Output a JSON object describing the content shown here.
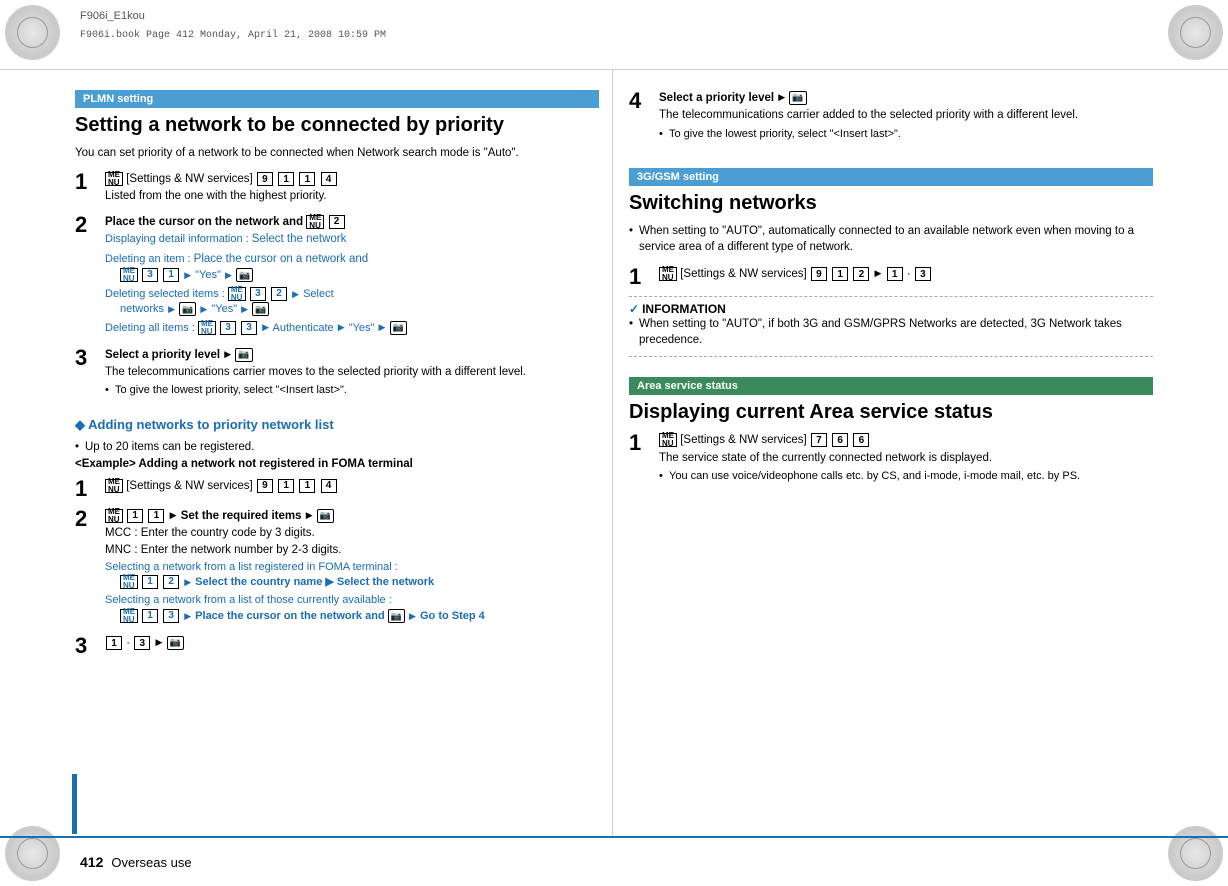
{
  "header": {
    "title": "F906i_E1kou",
    "subtitle": "F906i.book  Page 412  Monday, April 21, 2008  10:59 PM"
  },
  "page": {
    "number": "412",
    "label": "Overseas use"
  },
  "left_section": {
    "header": "PLMN setting",
    "title": "Setting a network to be connected by priority",
    "intro": "You can set priority of a network to be connected when Network search mode is \"Auto\".",
    "steps": [
      {
        "number": "1",
        "menu_label": "ME/NU",
        "keys": [
          "[Settings & NW services]",
          "9",
          "1",
          "1",
          "4"
        ],
        "body": "Listed from the one with the highest priority."
      },
      {
        "number": "2",
        "body": "Place the cursor on the network and",
        "menu_label": "ME/NU",
        "key2": "2",
        "sub_items": [
          {
            "label": "Displaying detail information :",
            "text": "Select the network"
          },
          {
            "label": "Deleting an item :",
            "text": "Place the cursor on a network and",
            "extra": "3 1 ▶ \"Yes\" ▶ 🔒"
          },
          {
            "label": "Deleting selected items :",
            "text": "3 2 ▶ Select networks ▶ 🔒 ▶ \"Yes\" ▶ 🔒"
          },
          {
            "label": "Deleting all items :",
            "text": "3 3 ▶ Authenticate ▶ \"Yes\" ▶ 🔒"
          }
        ]
      },
      {
        "number": "3",
        "body": "Select a priority level ▶ 🔒",
        "note": "The telecommunications carrier moves to the selected priority with a different level.",
        "bullet": "To give the lowest priority, select \"<Insert last>\"."
      }
    ],
    "adding_section": {
      "heading": "Adding networks to priority network list",
      "bullets": [
        "Up to 20 items can be registered.",
        "<Example> Adding a network not registered in FOMA terminal"
      ],
      "steps": [
        {
          "number": "1",
          "keys": [
            "[Settings & NW services]",
            "9",
            "1",
            "1",
            "4"
          ]
        },
        {
          "number": "2",
          "text": "1 1 ▶ Set the required items ▶ 🔒",
          "notes": [
            "MCC : Enter the country code by 3 digits.",
            "MNC : Enter the network number by 2-3 digits."
          ],
          "sub_items": [
            {
              "label": "Selecting a network from a list registered in FOMA terminal :",
              "text": "1 2 ▶ Select the country name ▶ Select the network"
            },
            {
              "label": "Selecting a network from a list of those currently available :",
              "text": "1 3 ▶ Place the cursor on the network and 🔒 ▶ Go to Step 4"
            }
          ]
        },
        {
          "number": "3",
          "text": "1 · 3 ▶ 🔒"
        }
      ]
    }
  },
  "right_section": {
    "step4": {
      "number": "4",
      "body": "Select a priority level ▶ 🔒",
      "note": "The telecommunications carrier added to the selected priority with a different level.",
      "bullet": "To give the lowest priority, select \"<Insert last>\"."
    },
    "gsm_section": {
      "header": "3G/GSM setting",
      "title": "Switching networks",
      "bullets": [
        "When setting to \"AUTO\", automatically connected to an available network even when moving to a service area of a different type of network."
      ],
      "step1": {
        "number": "1",
        "keys": [
          "[Settings & NW services]",
          "9",
          "1",
          "2",
          "▶",
          "1",
          "·",
          "3"
        ]
      },
      "info": {
        "title": "✓INFORMATION",
        "bullet": "When setting to \"AUTO\", if both 3G and GSM/GPRS Networks are detected, 3G Network takes precedence."
      }
    },
    "area_section": {
      "header": "Area service status",
      "title": "Displaying current Area service status",
      "step1": {
        "number": "1",
        "keys": [
          "[Settings & NW services]",
          "7",
          "6",
          "6"
        ]
      },
      "note": "The service state of the currently connected network is displayed.",
      "bullets": [
        "You can use voice/videophone calls etc. by CS, and i-mode, i-mode mail, etc. by PS."
      ]
    }
  }
}
